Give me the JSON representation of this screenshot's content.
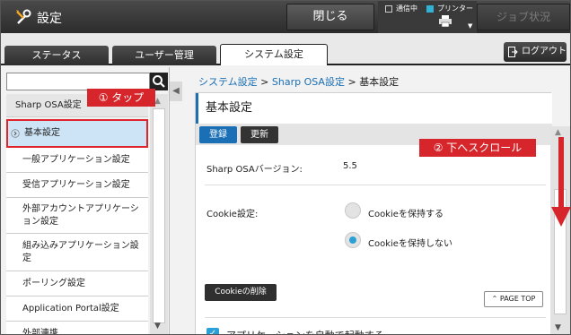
{
  "topbar": {
    "title": "設定",
    "close_label": "閉じる",
    "status_label": "通信中",
    "printer_label": "プリンター",
    "job_status_label": "ジョブ状況"
  },
  "tabs": [
    {
      "label": "ステータス"
    },
    {
      "label": "ユーザー管理"
    },
    {
      "label": "システム設定",
      "active": true
    }
  ],
  "logout_label": "ログアウト",
  "sidebar": {
    "search_placeholder": "",
    "group_label": "Sharp OSA設定",
    "items": [
      {
        "label": "基本設定",
        "selected": true
      },
      {
        "label": "一般アプリケーション設定"
      },
      {
        "label": "受信アプリケーション設定"
      },
      {
        "label": "外部アカウントアプリケーション設定"
      },
      {
        "label": "組み込みアプリケーション設定"
      },
      {
        "label": "ポーリング設定"
      },
      {
        "label": "Application Portal設定"
      },
      {
        "label": "外部連携"
      }
    ]
  },
  "callouts": {
    "tap": "① タップ",
    "scroll": "② 下へスクロール"
  },
  "breadcrumb": {
    "part1": "システム設定",
    "sep": " > ",
    "part2": "Sharp OSA設定",
    "part3": "基本設定"
  },
  "main": {
    "title": "基本設定",
    "register_label": "登録",
    "update_label": "更新",
    "version_label": "Sharp OSAバージョン:",
    "version_value": "5.5",
    "cookie_label": "Cookie設定:",
    "cookie_options": [
      {
        "label": "Cookieを保持する",
        "selected": false
      },
      {
        "label": "Cookieを保持しない",
        "selected": true
      }
    ],
    "cookie_delete_label": "Cookieの削除",
    "auto_start_label": "アプリケーションを自動で起動する",
    "page_top_label": "PAGE TOP"
  },
  "colors": {
    "accent": "#1a6fb5",
    "radio_on": "#2aa0d6",
    "annotation_red": "#d6262b"
  }
}
